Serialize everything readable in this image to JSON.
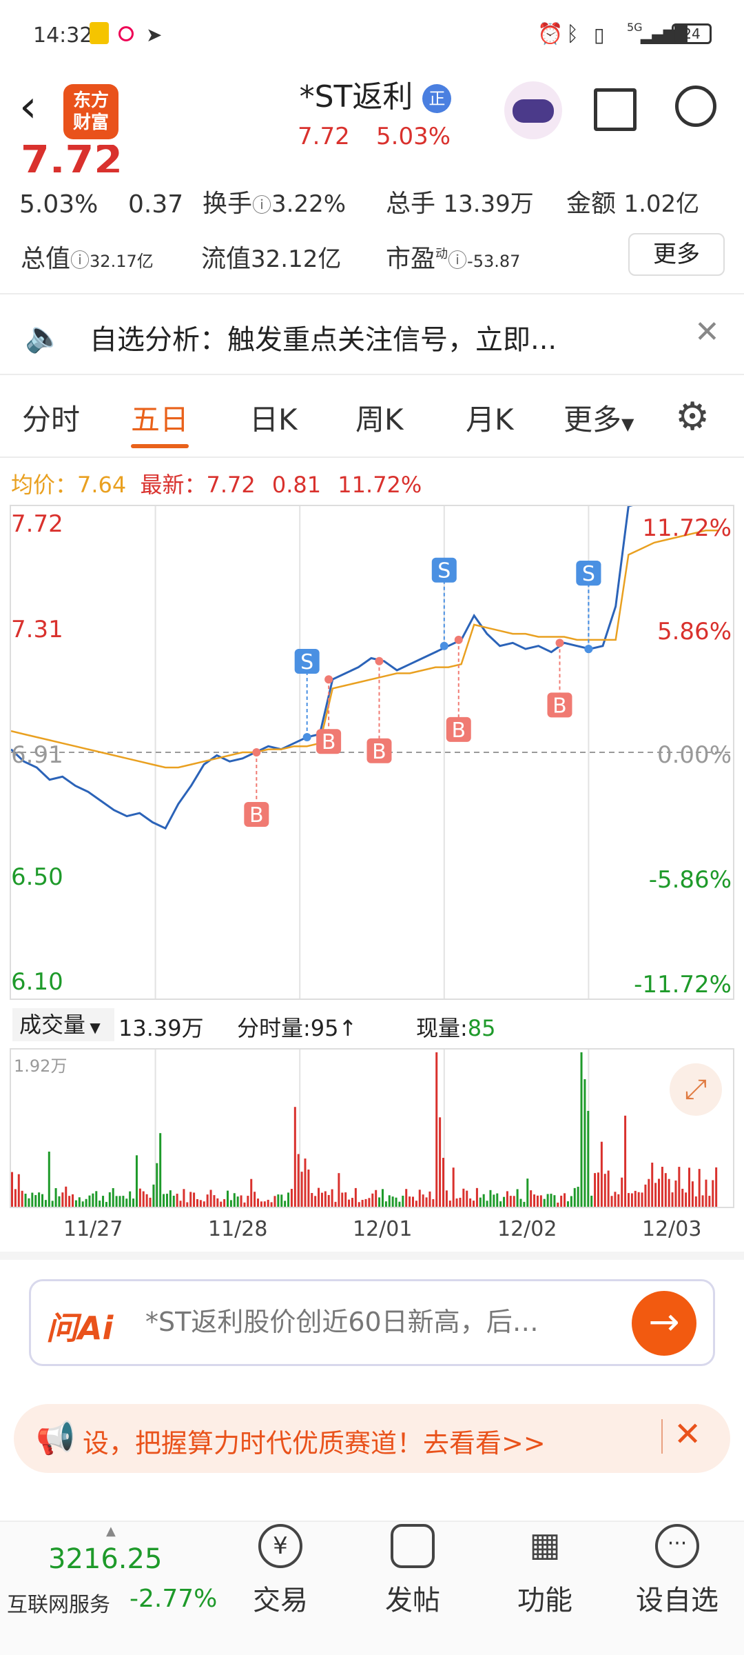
{
  "status_bar": {
    "time": "14:32",
    "battery": "24",
    "network": "5G"
  },
  "header": {
    "title": "*ST返利",
    "tag": "正",
    "price": "7.72",
    "change_pct": "5.03%",
    "logo_line1": "东方",
    "logo_line2": "财富"
  },
  "stats": {
    "big_price": "7.72",
    "change_pct": "5.03%",
    "change_amt": "0.37",
    "turnover_label": "换手",
    "turnover_value": "3.22%",
    "total_hands_label": "总手",
    "total_hands_value": "13.39万",
    "amount_label": "金额",
    "amount_value": "1.02亿",
    "total_mv_label": "总值",
    "total_mv_value": "32.17亿",
    "float_mv_label": "流值",
    "float_mv_value": "32.12亿",
    "pe_label": "市盈",
    "pe_sup": "动",
    "pe_value": "-53.87",
    "more_label": "更多"
  },
  "notice": {
    "text": "自选分析：触发重点关注信号，立即..."
  },
  "tabs": [
    "分时",
    "五日",
    "日K",
    "周K",
    "月K",
    "更多"
  ],
  "active_tab": 1,
  "chart_info": {
    "avg_label": "均价：",
    "avg_value": "7.64",
    "latest_label": "最新：",
    "latest_value": "7.72",
    "latest_change": "0.81",
    "latest_pct": "11.72%"
  },
  "chart_data": {
    "type": "line",
    "x": [
      "11/27",
      "11/28",
      "12/01",
      "12/02",
      "12/03"
    ],
    "left_ticks": [
      "7.72",
      "7.31",
      "6.91",
      "6.50",
      "6.10"
    ],
    "right_ticks": [
      "11.72%",
      "5.86%",
      "0.00%",
      "-5.86%",
      "-11.72%"
    ],
    "ylim": [
      6.1,
      7.72
    ],
    "base": 6.91,
    "series": [
      {
        "values": [
          6.92,
          6.88,
          6.86,
          6.82,
          6.83,
          6.8,
          6.78,
          6.75,
          6.72,
          6.7,
          6.71,
          6.68,
          6.66,
          6.74,
          6.8,
          6.87,
          6.9,
          6.88,
          6.89,
          6.91,
          6.93,
          6.92,
          6.94,
          6.96,
          6.97,
          7.15,
          7.17,
          7.19,
          7.22,
          7.21,
          7.18,
          7.2,
          7.22,
          7.24,
          7.26,
          7.28,
          7.36,
          7.3,
          7.26,
          7.27,
          7.25,
          7.26,
          7.24,
          7.27,
          7.26,
          7.25,
          7.26,
          7.39,
          7.72,
          7.73,
          7.74,
          7.74,
          7.75,
          7.75,
          7.76,
          7.76
        ]
      },
      {
        "values": [
          6.98,
          6.97,
          6.96,
          6.95,
          6.94,
          6.93,
          6.92,
          6.91,
          6.9,
          6.89,
          6.88,
          6.87,
          6.86,
          6.86,
          6.87,
          6.88,
          6.89,
          6.9,
          6.91,
          6.91,
          6.92,
          6.92,
          6.93,
          6.93,
          6.94,
          7.12,
          7.13,
          7.14,
          7.15,
          7.16,
          7.17,
          7.17,
          7.18,
          7.19,
          7.19,
          7.2,
          7.33,
          7.32,
          7.31,
          7.3,
          7.3,
          7.29,
          7.29,
          7.29,
          7.28,
          7.28,
          7.28,
          7.28,
          7.56,
          7.58,
          7.6,
          7.61,
          7.62,
          7.63,
          7.64,
          7.64
        ]
      }
    ],
    "signals": [
      {
        "type": "B",
        "day": 1.7
      },
      {
        "type": "S",
        "day": 2.05
      },
      {
        "type": "B",
        "day": 2.2
      },
      {
        "type": "B",
        "day": 2.55
      },
      {
        "type": "S",
        "day": 3.0
      },
      {
        "type": "B",
        "day": 3.1
      },
      {
        "type": "B",
        "day": 3.8
      },
      {
        "type": "S",
        "day": 4.0
      },
      {
        "type": "S",
        "day": 4.0
      }
    ]
  },
  "volume": {
    "label": "成交量",
    "total": "13.39万",
    "fenshi_label": "分时量:",
    "fenshi_value": "95",
    "now_label": "现量:",
    "now_value": "85",
    "max_label": "1.92万"
  },
  "ai": {
    "logo": "问Ai",
    "text": "*ST返利股价创近60日新高，后…"
  },
  "promo": {
    "text": "设，把握算力时代优质赛道！去看看>>"
  },
  "bottom_nav": {
    "index_value": "3216.25",
    "index_label": "互联网服务",
    "index_change": "-2.77%",
    "items": [
      "交易",
      "发帖",
      "功能",
      "设自选"
    ]
  }
}
